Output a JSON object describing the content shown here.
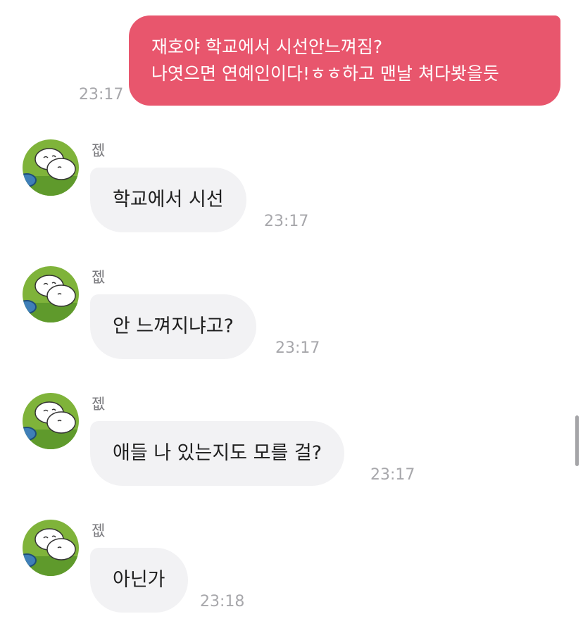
{
  "outgoing": {
    "lines": [
      "재호야 학교에서 시선안느껴짐?",
      "나엿으면 연예인이다!ㅎㅎ하고 맨날 쳐다봣을듯"
    ],
    "time": "23:17",
    "bubble_color": "#e8566d"
  },
  "incoming": [
    {
      "sender": "젮",
      "text": "학교에서 시선",
      "time": "23:17"
    },
    {
      "sender": "젮",
      "text": "안 느껴지냐고?",
      "time": "23:17"
    },
    {
      "sender": "젮",
      "text": "애들 나 있는지도 모를 걸?",
      "time": "23:17"
    },
    {
      "sender": "젮",
      "text": "아닌가",
      "time": "23:18"
    }
  ],
  "colors": {
    "incoming_bubble": "#f2f2f4",
    "timestamp": "#a7a7ab",
    "avatar_grass": "#7fb33a"
  },
  "icons": {
    "avatar": "cartoon-character-avatar"
  }
}
